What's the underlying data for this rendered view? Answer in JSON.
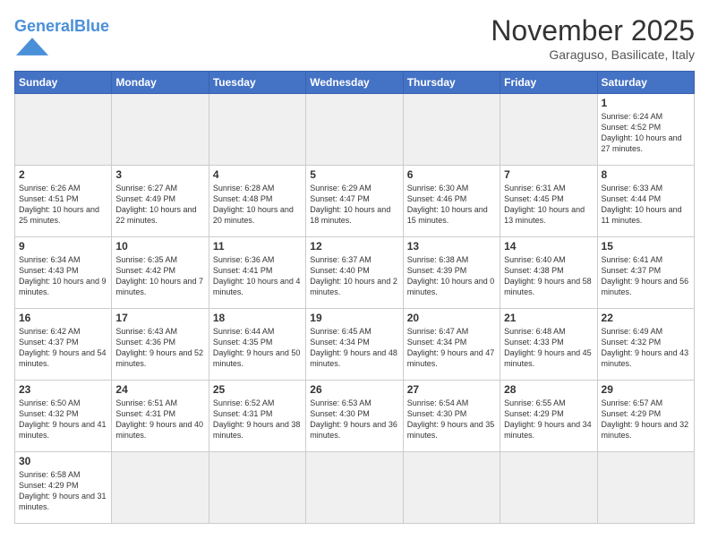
{
  "header": {
    "logo_general": "General",
    "logo_blue": "Blue",
    "month_title": "November 2025",
    "location": "Garaguso, Basilicate, Italy"
  },
  "weekdays": [
    "Sunday",
    "Monday",
    "Tuesday",
    "Wednesday",
    "Thursday",
    "Friday",
    "Saturday"
  ],
  "days": [
    {
      "date": "1",
      "sunrise": "6:24 AM",
      "sunset": "4:52 PM",
      "daylight": "10 hours and 27 minutes."
    },
    {
      "date": "2",
      "sunrise": "6:26 AM",
      "sunset": "4:51 PM",
      "daylight": "10 hours and 25 minutes."
    },
    {
      "date": "3",
      "sunrise": "6:27 AM",
      "sunset": "4:49 PM",
      "daylight": "10 hours and 22 minutes."
    },
    {
      "date": "4",
      "sunrise": "6:28 AM",
      "sunset": "4:48 PM",
      "daylight": "10 hours and 20 minutes."
    },
    {
      "date": "5",
      "sunrise": "6:29 AM",
      "sunset": "4:47 PM",
      "daylight": "10 hours and 18 minutes."
    },
    {
      "date": "6",
      "sunrise": "6:30 AM",
      "sunset": "4:46 PM",
      "daylight": "10 hours and 15 minutes."
    },
    {
      "date": "7",
      "sunrise": "6:31 AM",
      "sunset": "4:45 PM",
      "daylight": "10 hours and 13 minutes."
    },
    {
      "date": "8",
      "sunrise": "6:33 AM",
      "sunset": "4:44 PM",
      "daylight": "10 hours and 11 minutes."
    },
    {
      "date": "9",
      "sunrise": "6:34 AM",
      "sunset": "4:43 PM",
      "daylight": "10 hours and 9 minutes."
    },
    {
      "date": "10",
      "sunrise": "6:35 AM",
      "sunset": "4:42 PM",
      "daylight": "10 hours and 7 minutes."
    },
    {
      "date": "11",
      "sunrise": "6:36 AM",
      "sunset": "4:41 PM",
      "daylight": "10 hours and 4 minutes."
    },
    {
      "date": "12",
      "sunrise": "6:37 AM",
      "sunset": "4:40 PM",
      "daylight": "10 hours and 2 minutes."
    },
    {
      "date": "13",
      "sunrise": "6:38 AM",
      "sunset": "4:39 PM",
      "daylight": "10 hours and 0 minutes."
    },
    {
      "date": "14",
      "sunrise": "6:40 AM",
      "sunset": "4:38 PM",
      "daylight": "9 hours and 58 minutes."
    },
    {
      "date": "15",
      "sunrise": "6:41 AM",
      "sunset": "4:37 PM",
      "daylight": "9 hours and 56 minutes."
    },
    {
      "date": "16",
      "sunrise": "6:42 AM",
      "sunset": "4:37 PM",
      "daylight": "9 hours and 54 minutes."
    },
    {
      "date": "17",
      "sunrise": "6:43 AM",
      "sunset": "4:36 PM",
      "daylight": "9 hours and 52 minutes."
    },
    {
      "date": "18",
      "sunrise": "6:44 AM",
      "sunset": "4:35 PM",
      "daylight": "9 hours and 50 minutes."
    },
    {
      "date": "19",
      "sunrise": "6:45 AM",
      "sunset": "4:34 PM",
      "daylight": "9 hours and 48 minutes."
    },
    {
      "date": "20",
      "sunrise": "6:47 AM",
      "sunset": "4:34 PM",
      "daylight": "9 hours and 47 minutes."
    },
    {
      "date": "21",
      "sunrise": "6:48 AM",
      "sunset": "4:33 PM",
      "daylight": "9 hours and 45 minutes."
    },
    {
      "date": "22",
      "sunrise": "6:49 AM",
      "sunset": "4:32 PM",
      "daylight": "9 hours and 43 minutes."
    },
    {
      "date": "23",
      "sunrise": "6:50 AM",
      "sunset": "4:32 PM",
      "daylight": "9 hours and 41 minutes."
    },
    {
      "date": "24",
      "sunrise": "6:51 AM",
      "sunset": "4:31 PM",
      "daylight": "9 hours and 40 minutes."
    },
    {
      "date": "25",
      "sunrise": "6:52 AM",
      "sunset": "4:31 PM",
      "daylight": "9 hours and 38 minutes."
    },
    {
      "date": "26",
      "sunrise": "6:53 AM",
      "sunset": "4:30 PM",
      "daylight": "9 hours and 36 minutes."
    },
    {
      "date": "27",
      "sunrise": "6:54 AM",
      "sunset": "4:30 PM",
      "daylight": "9 hours and 35 minutes."
    },
    {
      "date": "28",
      "sunrise": "6:55 AM",
      "sunset": "4:29 PM",
      "daylight": "9 hours and 34 minutes."
    },
    {
      "date": "29",
      "sunrise": "6:57 AM",
      "sunset": "4:29 PM",
      "daylight": "9 hours and 32 minutes."
    },
    {
      "date": "30",
      "sunrise": "6:58 AM",
      "sunset": "4:29 PM",
      "daylight": "9 hours and 31 minutes."
    }
  ]
}
